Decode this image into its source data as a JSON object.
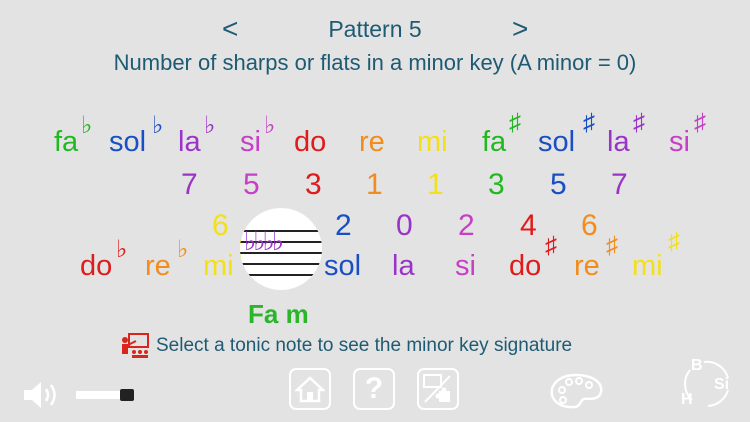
{
  "header": {
    "title": "Pattern 5",
    "subtitle": "Number of sharps or flats in a minor key (A minor = 0)",
    "prev_arrow": "<",
    "next_arrow": ">"
  },
  "row1_notes": [
    {
      "name": "fa",
      "acc": "♭",
      "color": "#22b822"
    },
    {
      "name": "sol",
      "acc": "♭",
      "color": "#1a4fc4"
    },
    {
      "name": "la",
      "acc": "♭",
      "color": "#9b33c9"
    },
    {
      "name": "si",
      "acc": "♭",
      "color": "#c73fc7"
    },
    {
      "name": "do",
      "acc": "",
      "color": "#e01b1b"
    },
    {
      "name": "re",
      "acc": "",
      "color": "#f28c1c"
    },
    {
      "name": "mi",
      "acc": "",
      "color": "#f2e01c"
    },
    {
      "name": "fa",
      "acc": "♯",
      "color": "#22b822"
    },
    {
      "name": "sol",
      "acc": "♯",
      "color": "#1a4fc4"
    },
    {
      "name": "la",
      "acc": "♯",
      "color": "#9b33c9"
    },
    {
      "name": "si",
      "acc": "♯",
      "color": "#c73fc7"
    }
  ],
  "row1_numbers": [
    {
      "value": "7",
      "color": "#9b33c9"
    },
    {
      "value": "5",
      "color": "#c73fc7"
    },
    {
      "value": "3",
      "color": "#e01b1b"
    },
    {
      "value": "1",
      "color": "#f28c1c"
    },
    {
      "value": "1",
      "color": "#f2e01c"
    },
    {
      "value": "3",
      "color": "#22b822"
    },
    {
      "value": "5",
      "color": "#1a4fc4"
    },
    {
      "value": "7",
      "color": "#9b33c9"
    }
  ],
  "row2_numbers": [
    {
      "value": "6",
      "color": "#f2e01c"
    },
    {
      "value": "2",
      "color": "#1a4fc4"
    },
    {
      "value": "0",
      "color": "#9b33c9"
    },
    {
      "value": "2",
      "color": "#c73fc7"
    },
    {
      "value": "4",
      "color": "#e01b1b"
    },
    {
      "value": "6",
      "color": "#f28c1c"
    }
  ],
  "row2_notes": [
    {
      "name": "do",
      "acc": "♭",
      "color": "#e01b1b"
    },
    {
      "name": "re",
      "acc": "♭",
      "color": "#f28c1c"
    },
    {
      "name": "mi",
      "acc": "♭",
      "color": "#f2e01c"
    },
    {
      "name": "sol",
      "acc": "",
      "color": "#1a4fc4"
    },
    {
      "name": "la",
      "acc": "",
      "color": "#9b33c9"
    },
    {
      "name": "si",
      "acc": "",
      "color": "#c73fc7"
    },
    {
      "name": "do",
      "acc": "♯",
      "color": "#e01b1b"
    },
    {
      "name": "re",
      "acc": "♯",
      "color": "#f28c1c"
    },
    {
      "name": "mi",
      "acc": "♯",
      "color": "#f2e01c"
    }
  ],
  "selection": {
    "tonic_label": "Fa m",
    "flats": "♭♭♭♭",
    "flat_color": "#9b33c9"
  },
  "instruction": {
    "icon": "teacher-icon",
    "text": "Select a tonic note to see the minor key signature"
  },
  "footer": {
    "volume_icon": "speaker-icon",
    "help_label": "?",
    "note_b": "B",
    "note_si": "Si",
    "note_h": "H"
  }
}
